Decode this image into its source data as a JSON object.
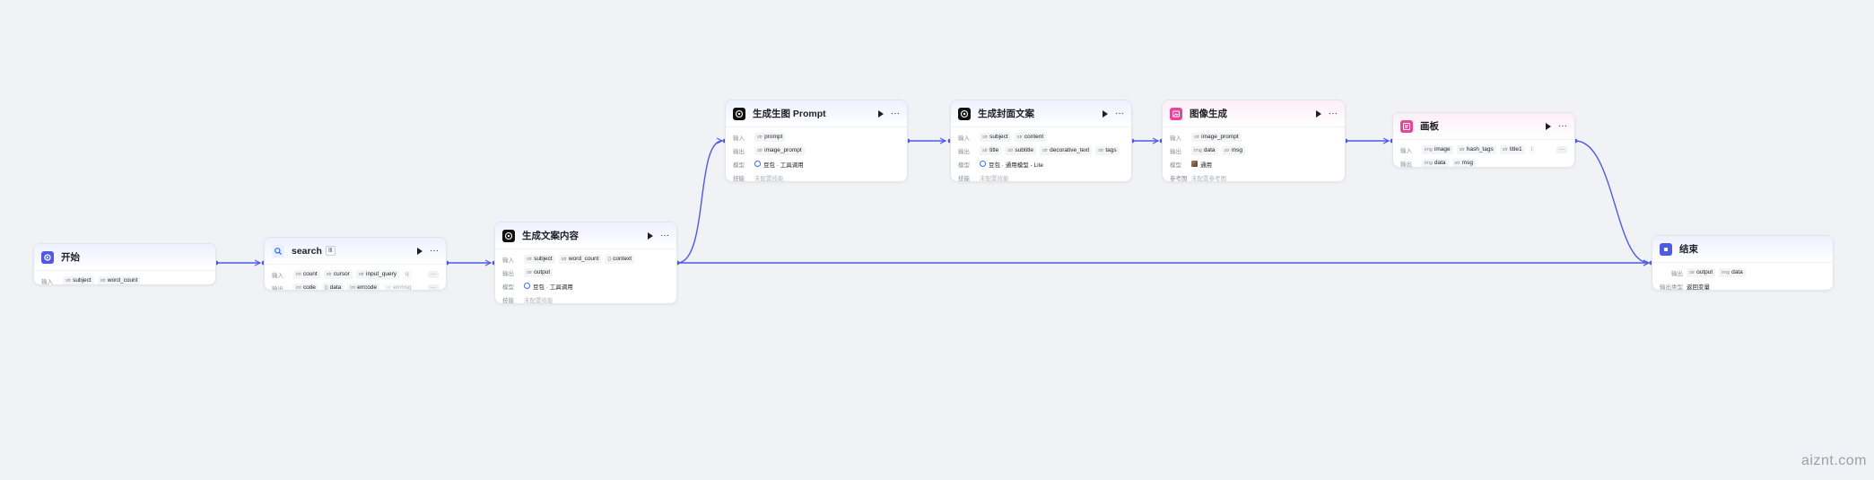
{
  "canvas": {
    "background": "#f1f2f5",
    "edge_color": "#4e5ae6"
  },
  "labels": {
    "input": "输入",
    "output": "输出",
    "model": "模型",
    "skills": "技能",
    "ref_image": "参考图",
    "output_var": "输出类型"
  },
  "nodes": {
    "start": {
      "title": "开始",
      "icon": "start-icon",
      "inputs": [
        "subject",
        "word_count"
      ]
    },
    "search": {
      "title": "search",
      "badge": "Ⅲ",
      "icon": "search-plugin-icon",
      "inputs": [
        "count",
        "cursor",
        "input_query",
        "q"
      ],
      "outputs": [
        "code",
        "data",
        "errcode",
        "errmsg"
      ],
      "more": "···"
    },
    "gen_content": {
      "title": "生成文案内容",
      "icon": "llm-icon",
      "inputs": [
        "subject",
        "word_count",
        "context"
      ],
      "outputs": [
        "output"
      ],
      "model": "豆包 · 工具调用",
      "skills": "未配置技能"
    },
    "gen_prompt": {
      "title": "生成生图 Prompt",
      "icon": "llm-icon",
      "inputs": [
        "prompt"
      ],
      "outputs": [
        "image_prompt"
      ],
      "model": "豆包 · 工具调用",
      "skills": "未配置技能"
    },
    "gen_cover": {
      "title": "生成封面文案",
      "icon": "llm-icon",
      "inputs": [
        "subject",
        "content"
      ],
      "outputs": [
        "title",
        "subtitle",
        "decorative_text",
        "tags"
      ],
      "model": "豆包 · 通用模型 - Lite",
      "skills": "未配置技能"
    },
    "image_gen": {
      "title": "图像生成",
      "icon": "image-gen-icon",
      "inputs": [
        "image_prompt"
      ],
      "outputs": [
        "data",
        "msg"
      ],
      "model": "通用",
      "ref": "未配置参考图"
    },
    "board": {
      "title": "画板",
      "icon": "canvas-board-icon",
      "inputs": [
        "image",
        "hash_tags",
        "title1",
        "t"
      ],
      "outputs": [
        "data",
        "msg"
      ],
      "more": "···"
    },
    "end": {
      "title": "结束",
      "icon": "end-icon",
      "outputs": [
        "output",
        "data"
      ],
      "output_type": "返回变量"
    }
  },
  "head": {
    "run": "run-icon",
    "more": "···"
  },
  "watermark": "aiznt.com"
}
